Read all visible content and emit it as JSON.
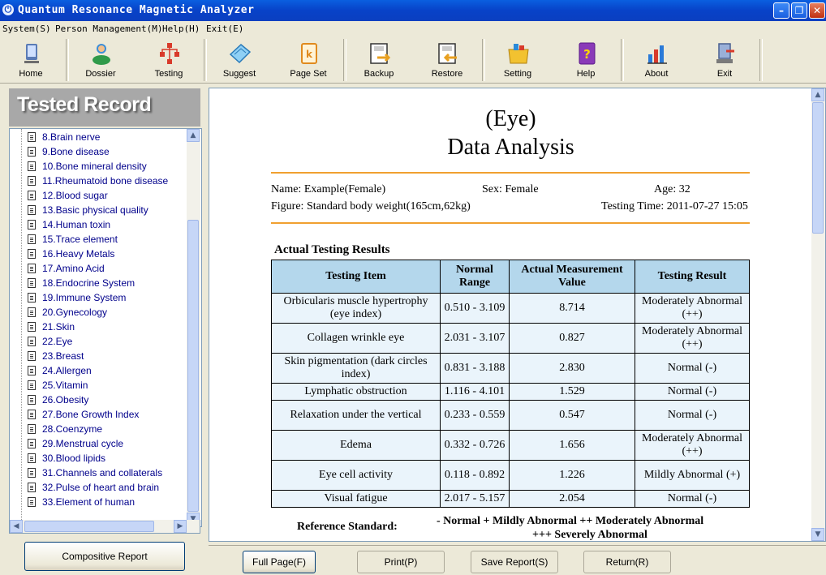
{
  "window": {
    "title": "Quantum Resonance Magnetic Analyzer"
  },
  "menu": [
    "System(S)",
    "Person Management(M)",
    "Help(H)",
    "Exit(E)"
  ],
  "toolbar": [
    {
      "label": "Home",
      "icon": "home-icon"
    },
    {
      "label": "Dossier",
      "icon": "dossier-icon"
    },
    {
      "label": "Testing",
      "icon": "testing-icon"
    },
    {
      "label": "Suggest",
      "icon": "suggest-icon"
    },
    {
      "label": "Page Set",
      "icon": "page-set-icon"
    },
    {
      "label": "Backup",
      "icon": "backup-icon"
    },
    {
      "label": "Restore",
      "icon": "restore-icon"
    },
    {
      "label": "Setting",
      "icon": "setting-icon"
    },
    {
      "label": "Help",
      "icon": "help-icon"
    },
    {
      "label": "About",
      "icon": "about-icon"
    },
    {
      "label": "Exit",
      "icon": "exit-icon"
    }
  ],
  "left": {
    "header": "Tested Record",
    "items": [
      "8.Brain nerve",
      "9.Bone disease",
      "10.Bone mineral density",
      "11.Rheumatoid bone disease",
      "12.Blood sugar",
      "13.Basic physical quality",
      "14.Human toxin",
      "15.Trace element",
      "16.Heavy Metals",
      "17.Amino Acid",
      "18.Endocrine System",
      "19.Immune System",
      "20.Gynecology",
      "21.Skin",
      "22.Eye",
      "23.Breast",
      "24.Allergen",
      "25.Vitamin",
      "26.Obesity",
      "27.Bone Growth Index",
      "28.Coenzyme",
      "29.Menstrual cycle",
      "30.Blood lipids",
      "31.Channels and collaterals",
      "32.Pulse of heart and brain",
      "33.Element of human"
    ],
    "composite_button": "Compositive Report"
  },
  "report": {
    "title1": "(Eye)",
    "title2": "Data Analysis",
    "name": "Name: Example(Female)",
    "sex": "Sex: Female",
    "age": "Age: 32",
    "figure": "Figure: Standard body weight(165cm,62kg)",
    "testing_time": "Testing Time: 2011-07-27 15:05",
    "section": "Actual Testing Results",
    "columns": [
      "Testing Item",
      "Normal Range",
      "Actual Measurement Value",
      "Testing Result"
    ],
    "rows": [
      [
        "Orbicularis muscle hypertrophy (eye index)",
        "0.510 - 3.109",
        "8.714",
        "Moderately Abnormal (++)"
      ],
      [
        "Collagen wrinkle eye",
        "2.031 - 3.107",
        "0.827",
        "Moderately Abnormal (++)"
      ],
      [
        "Skin pigmentation (dark circles index)",
        "0.831 - 3.188",
        "2.830",
        "Normal (-)"
      ],
      [
        "Lymphatic obstruction",
        "1.116 - 4.101",
        "1.529",
        "Normal (-)"
      ],
      [
        "Relaxation under the vertical",
        "0.233 - 0.559",
        "0.547",
        "Normal (-)"
      ],
      [
        "Edema",
        "0.332 - 0.726",
        "1.656",
        "Moderately Abnormal (++)"
      ],
      [
        "Eye cell activity",
        "0.118 - 0.892",
        "1.226",
        "Mildly Abnormal (+)"
      ],
      [
        "Visual fatigue",
        "2.017 - 5.157",
        "2.054",
        "Normal (-)"
      ]
    ],
    "reference_label": "Reference Standard:",
    "legend_line1": "- Normal    + Mildly Abnormal    ++ Moderately Abnormal",
    "legend_line2": "+++ Severely Abnormal"
  },
  "bottom_buttons": [
    "Full Page(F)",
    "Print(P)",
    "Save Report(S)",
    "Return(R)"
  ]
}
